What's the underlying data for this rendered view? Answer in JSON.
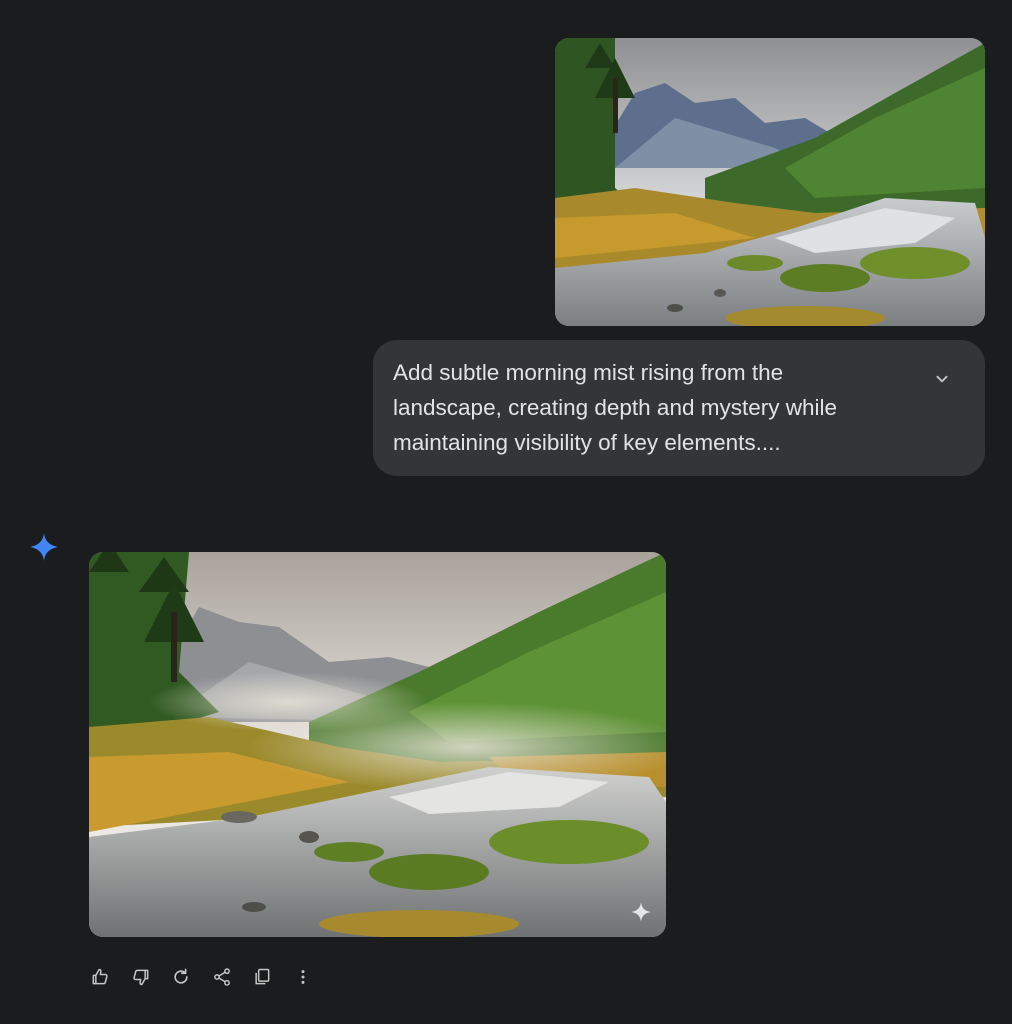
{
  "conversation": {
    "user_message": {
      "image_alt_icon": "mountain-river-landscape-photo",
      "prompt_text": "Add subtle morning mist rising from the\nlandscape, creating depth and mystery while\nmaintaining visibility of key elements....",
      "expand_icon": "chevron-down-icon"
    },
    "model_response": {
      "avatar_icon": "spark-icon",
      "image_alt_icon": "misty-mountain-river-landscape-photo",
      "watermark_icon": "spark-watermark-icon"
    }
  },
  "toolbar": {
    "actions": [
      {
        "name": "thumbs-up-icon"
      },
      {
        "name": "thumbs-down-icon"
      },
      {
        "name": "regenerate-icon"
      },
      {
        "name": "share-icon"
      },
      {
        "name": "copy-icon"
      },
      {
        "name": "more-options-icon"
      }
    ]
  },
  "colors": {
    "background": "#1b1c1d",
    "bubble": "#333537",
    "text": "#e3e3e3",
    "accent_spark": "#4285f4",
    "icon": "#c4c7c5"
  }
}
